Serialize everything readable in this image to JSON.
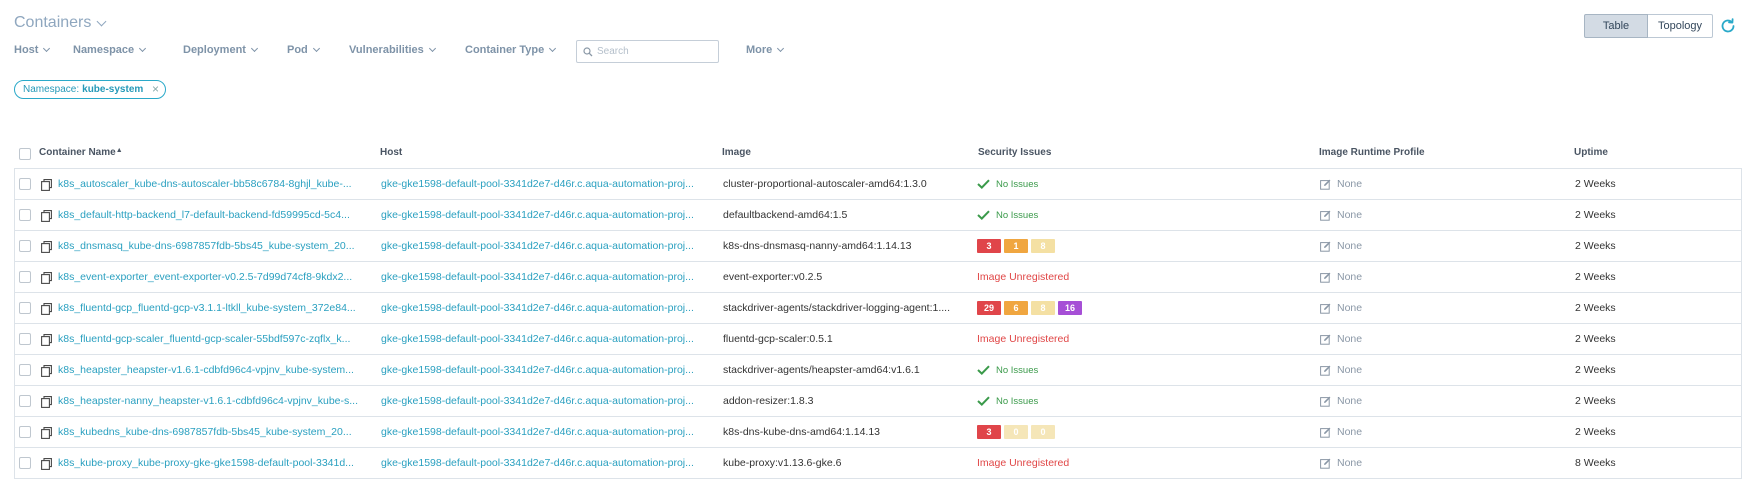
{
  "page": {
    "title": "Containers"
  },
  "view_toggle": {
    "table": "Table",
    "topology": "Topology"
  },
  "filters": [
    "Host",
    "Namespace",
    "Deployment",
    "Pod",
    "Vulnerabilities",
    "Container Type",
    "More"
  ],
  "search": {
    "placeholder": "Search",
    "value": ""
  },
  "active_filter": {
    "key": "Namespace:",
    "value": "kube-system",
    "close": "×"
  },
  "table": {
    "columns": {
      "name": "Container Name",
      "host": "Host",
      "image": "Image",
      "security": "Security Issues",
      "profile": "Image Runtime Profile",
      "uptime": "Uptime"
    },
    "sort_indicator": "▲",
    "rows": [
      {
        "name": "k8s_autoscaler_kube-dns-autoscaler-bb58c6784-8ghjl_kube-...",
        "host": "gke-gke1598-default-pool-3341d2e7-d46r.c.aqua-automation-proj...",
        "image": "cluster-proportional-autoscaler-amd64:1.3.0",
        "security": {
          "type": "ok",
          "text": "No Issues"
        },
        "profile": "None",
        "uptime": "2 Weeks"
      },
      {
        "name": "k8s_default-http-backend_l7-default-backend-fd59995cd-5c4...",
        "host": "gke-gke1598-default-pool-3341d2e7-d46r.c.aqua-automation-proj...",
        "image": "defaultbackend-amd64:1.5",
        "security": {
          "type": "ok",
          "text": "No Issues"
        },
        "profile": "None",
        "uptime": "2 Weeks"
      },
      {
        "name": "k8s_dnsmasq_kube-dns-6987857fdb-5bs45_kube-system_20...",
        "host": "gke-gke1598-default-pool-3341d2e7-d46r.c.aqua-automation-proj...",
        "image": "k8s-dns-dnsmasq-nanny-amd64:1.14.13",
        "security": {
          "type": "badges",
          "badges": [
            {
              "text": "3",
              "color": "#e0454a"
            },
            {
              "text": "1",
              "color": "#f0a640"
            },
            {
              "text": "8",
              "color": "#f4e0a3"
            }
          ]
        },
        "profile": "None",
        "uptime": "2 Weeks"
      },
      {
        "name": "k8s_event-exporter_event-exporter-v0.2.5-7d99d74cf8-9kdx2...",
        "host": "gke-gke1598-default-pool-3341d2e7-d46r.c.aqua-automation-proj...",
        "image": "event-exporter:v0.2.5",
        "security": {
          "type": "warn",
          "text": "Image Unregistered"
        },
        "profile": "None",
        "uptime": "2 Weeks"
      },
      {
        "name": "k8s_fluentd-gcp_fluentd-gcp-v3.1.1-ltkll_kube-system_372e84...",
        "host": "gke-gke1598-default-pool-3341d2e7-d46r.c.aqua-automation-proj...",
        "image": "stackdriver-agents/stackdriver-logging-agent:1....",
        "security": {
          "type": "badges",
          "badges": [
            {
              "text": "29",
              "color": "#e0454a"
            },
            {
              "text": "6",
              "color": "#f0a640"
            },
            {
              "text": "8",
              "color": "#f4e0a3"
            },
            {
              "text": "16",
              "color": "#a64fd6"
            }
          ]
        },
        "profile": "None",
        "uptime": "2 Weeks"
      },
      {
        "name": "k8s_fluentd-gcp-scaler_fluentd-gcp-scaler-55bdf597c-zqflx_k...",
        "host": "gke-gke1598-default-pool-3341d2e7-d46r.c.aqua-automation-proj...",
        "image": "fluentd-gcp-scaler:0.5.1",
        "security": {
          "type": "warn",
          "text": "Image Unregistered"
        },
        "profile": "None",
        "uptime": "2 Weeks"
      },
      {
        "name": "k8s_heapster_heapster-v1.6.1-cdbfd96c4-vpjnv_kube-system...",
        "host": "gke-gke1598-default-pool-3341d2e7-d46r.c.aqua-automation-proj...",
        "image": "stackdriver-agents/heapster-amd64:v1.6.1",
        "security": {
          "type": "ok",
          "text": "No Issues"
        },
        "profile": "None",
        "uptime": "2 Weeks"
      },
      {
        "name": "k8s_heapster-nanny_heapster-v1.6.1-cdbfd96c4-vpjnv_kube-s...",
        "host": "gke-gke1598-default-pool-3341d2e7-d46r.c.aqua-automation-proj...",
        "image": "addon-resizer:1.8.3",
        "security": {
          "type": "ok",
          "text": "No Issues"
        },
        "profile": "None",
        "uptime": "2 Weeks"
      },
      {
        "name": "k8s_kubedns_kube-dns-6987857fdb-5bs45_kube-system_20...",
        "host": "gke-gke1598-default-pool-3341d2e7-d46r.c.aqua-automation-proj...",
        "image": "k8s-dns-kube-dns-amd64:1.14.13",
        "security": {
          "type": "badges",
          "badges": [
            {
              "text": "3",
              "color": "#e0454a"
            },
            {
              "text": "0",
              "color": "#f5e6b8"
            },
            {
              "text": "0",
              "color": "#f5e6b8"
            }
          ]
        },
        "profile": "None",
        "uptime": "2 Weeks"
      },
      {
        "name": "k8s_kube-proxy_kube-proxy-gke-gke1598-default-pool-3341d...",
        "host": "gke-gke1598-default-pool-3341d2e7-d46r.c.aqua-automation-proj...",
        "image": "kube-proxy:v1.13.6-gke.6",
        "security": {
          "type": "warn",
          "text": "Image Unregistered"
        },
        "profile": "None",
        "uptime": "8 Weeks"
      }
    ]
  },
  "colors": {
    "accent": "#2aa0c0",
    "ok": "#3a9a4a",
    "error": "#e04646",
    "title": "#8fa7bf"
  },
  "icons": {
    "row": "container-icon",
    "ok": "check-icon",
    "profile": "edit-icon",
    "search": "search-icon",
    "refresh": "refresh-icon",
    "chevron": "chevron-down-icon"
  }
}
